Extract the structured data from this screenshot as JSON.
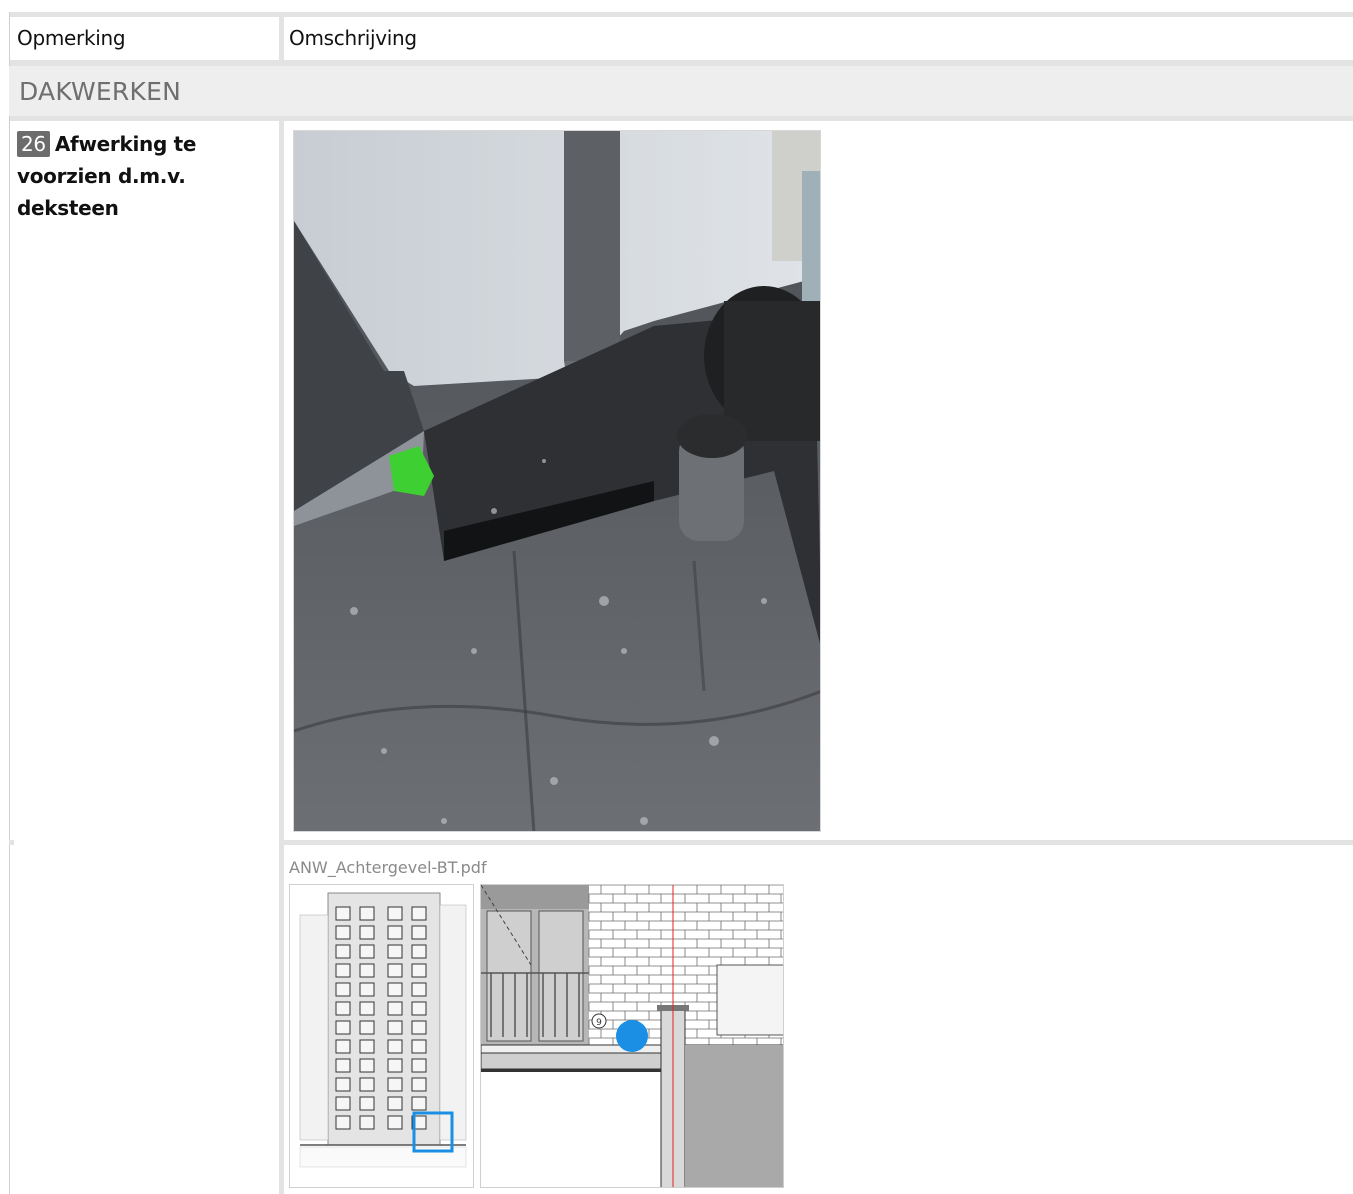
{
  "table": {
    "col_remark_header": "Opmerking",
    "col_description_header": "Omschrijving"
  },
  "section": {
    "title": "DAKWERKEN"
  },
  "item": {
    "number": "26",
    "text": "Afwerking te voorzien d.m.v. deksteen"
  },
  "attachment": {
    "file_name": "ANW_Achtergevel-BT.pdf",
    "marker_label": "9"
  },
  "colors": {
    "grid_line": "#e3e3e3",
    "section_bg": "#eeeeee",
    "badge_bg": "#6c6c6c",
    "highlight_blue": "#1a8fe3"
  }
}
